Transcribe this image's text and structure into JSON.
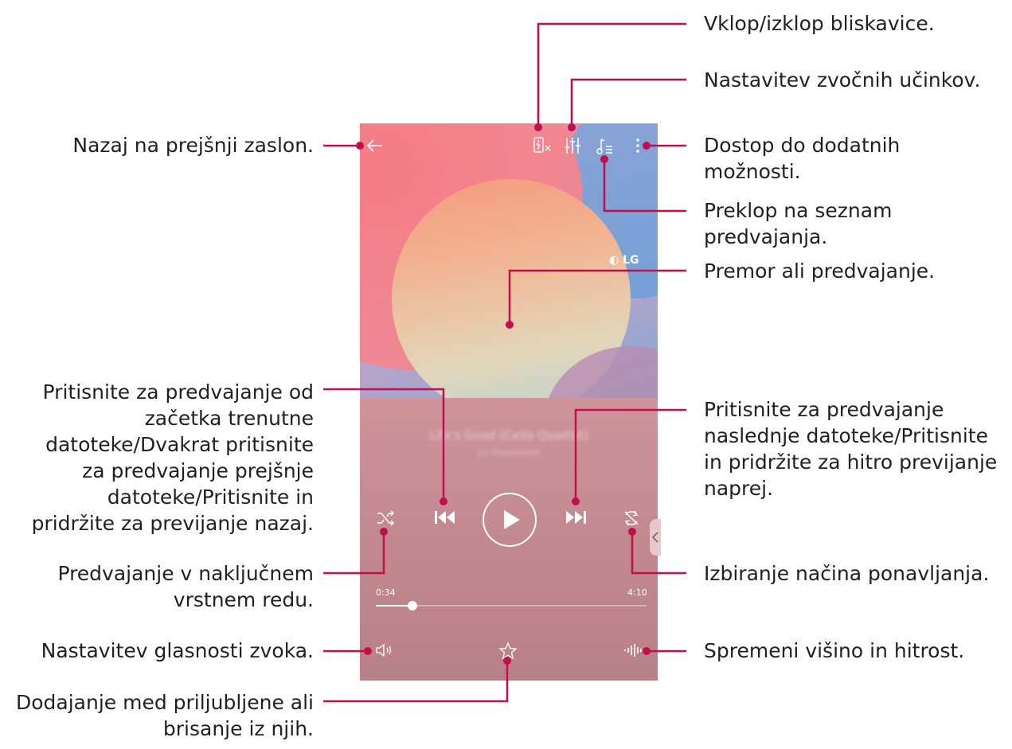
{
  "labels": {
    "flash": "Vklop/izklop bliskavice.",
    "sound_effects": "Nastavitev zvočnih učinkov.",
    "back": "Nazaj na prejšnji zaslon.",
    "more_options_1": "Dostop do dodatnih",
    "more_options_2": "možnosti.",
    "playlist_1": "Preklop na seznam",
    "playlist_2": "predvajanja.",
    "play_pause": "Premor ali predvajanje.",
    "previous_1": "Pritisnite za predvajanje od",
    "previous_2": "začetka trenutne",
    "previous_3": "datoteke/Dvakrat pritisnite",
    "previous_4": "za predvajanje prejšnje",
    "previous_5": "datoteke/Pritisnite in",
    "previous_6": "pridržite za previjanje nazaj.",
    "next_1": "Pritisnite za predvajanje",
    "next_2": "naslednje datoteke/Pritisnite",
    "next_3": "in pridržite za hitro previjanje",
    "next_4": "naprej.",
    "shuffle_1": "Predvajanje v naključnem",
    "shuffle_2": "vrstnem redu.",
    "repeat": "Izbiranje načina ponavljanja.",
    "volume": "Nastavitev glasnosti zvoka.",
    "pitch_speed": "Spremeni višino in hitrost.",
    "favorite_1": "Dodajanje med priljubljene ali",
    "favorite_2": "brisanje iz njih."
  },
  "player": {
    "logo": "LG",
    "song_title": "Life's Good (Cello Quartet)",
    "song_artist": "LG Electronics",
    "time_elapsed": "0:34",
    "time_total": "4:10",
    "progress_fraction": 0.136
  },
  "colors": {
    "leader": "#c30e4d",
    "text": "#231f20"
  },
  "icons": [
    "back-arrow-icon",
    "flash-icon",
    "equalizer-icon",
    "playlist-icon",
    "more-vert-icon",
    "previous-icon",
    "play-icon",
    "next-icon",
    "shuffle-icon",
    "repeat-icon",
    "volume-icon",
    "star-icon",
    "pitch-speed-icon",
    "chevron-left-icon"
  ]
}
